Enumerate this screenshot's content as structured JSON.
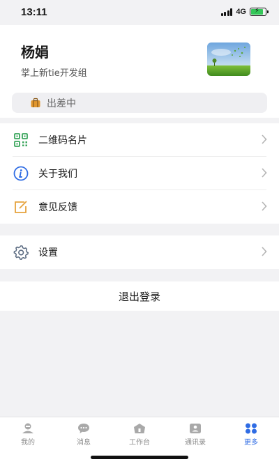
{
  "status_bar": {
    "time": "13:11",
    "network": "4G",
    "battery_level": 0.85
  },
  "profile": {
    "name": "杨娟",
    "department": "掌上新tie开发组",
    "status_label": "出差中"
  },
  "menu": {
    "group1": [
      {
        "label": "二维码名片",
        "icon": "qr-code-icon"
      },
      {
        "label": "关于我们",
        "icon": "info-icon"
      },
      {
        "label": "意见反馈",
        "icon": "feedback-edit-icon"
      }
    ],
    "group2": [
      {
        "label": "设置",
        "icon": "gear-icon"
      }
    ]
  },
  "logout_label": "退出登录",
  "tabs": [
    {
      "label": "我的",
      "icon": "profile-icon",
      "active": false
    },
    {
      "label": "消息",
      "icon": "message-icon",
      "active": false
    },
    {
      "label": "工作台",
      "icon": "workbench-icon",
      "active": false
    },
    {
      "label": "通讯录",
      "icon": "contacts-icon",
      "active": false
    },
    {
      "label": "更多",
      "icon": "more-grid-icon",
      "active": true
    }
  ],
  "colors": {
    "accent": "#2f6ce4",
    "background": "#f2f2f4",
    "qr_icon": "#3aa55c",
    "info_icon": "#2f6ce4",
    "feedback_icon": "#e6a23c",
    "settings_icon": "#5a6a80",
    "status_icon": "#e0962e"
  }
}
